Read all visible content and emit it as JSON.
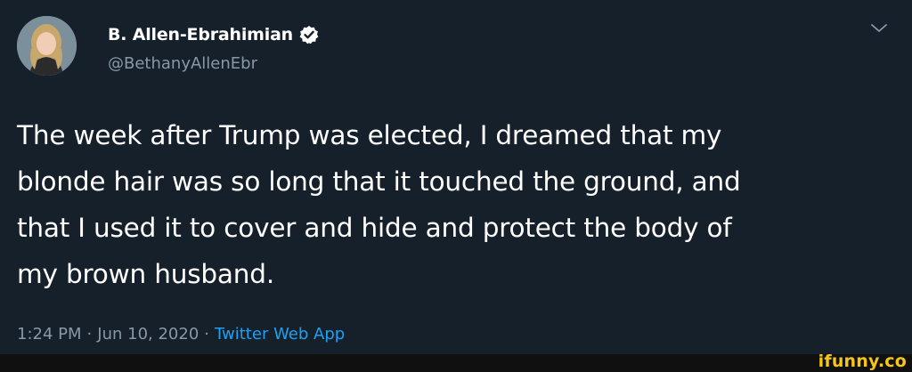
{
  "tweet": {
    "display_name": "B. Allen-Ebrahimian",
    "handle": "@BethanyAllenEbr",
    "body": "The week after Trump was elected, I dreamed that my\nblonde hair was so long that it touched the ground, and\nthat I used it to cover and hide and protect the body of\nmy brown husband.",
    "time": "1:24 PM",
    "separator": "·",
    "date": "Jun 10, 2020",
    "source": "Twitter Web App"
  },
  "watermark": "ifunny.co",
  "colors": {
    "background": "#15202b",
    "secondary_text": "#8899a6",
    "link": "#1da1f2",
    "verified": "#ffffff",
    "watermark": "#f5c518"
  },
  "icons": {
    "verified": "verified-badge-icon",
    "menu": "chevron-down-icon"
  }
}
